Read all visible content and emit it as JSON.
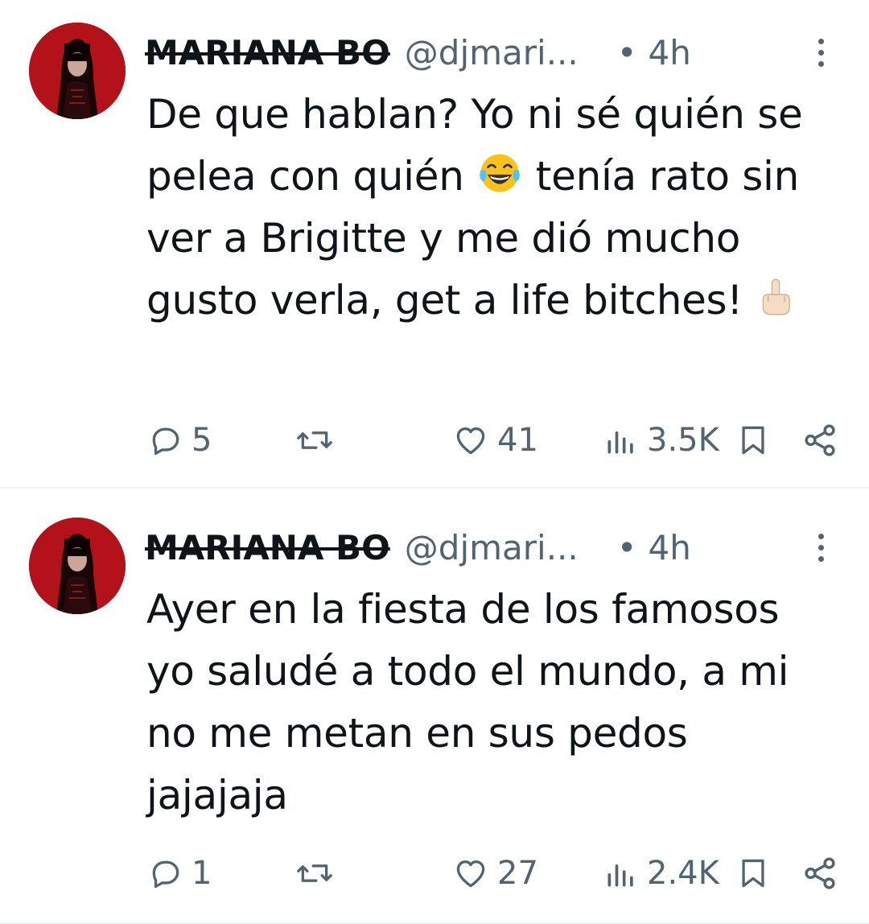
{
  "tweets": [
    {
      "display_name": "MARIANA BO",
      "handle": "@djmari...",
      "dot": "•",
      "time": "4h",
      "text_parts": [
        "De que hablan? Yo ni sé quién se pelea con quién ",
        " tenía rato sin ver a Brigitte y me dió mucho gusto verla, get a life bitches! "
      ],
      "emojis": [
        "face-with-tears-of-joy",
        "middle-finger"
      ],
      "replies": "5",
      "reposts": "",
      "likes": "41",
      "views": "3.5K"
    },
    {
      "display_name": "MARIANA BO",
      "handle": "@djmari...",
      "dot": "•",
      "time": "4h",
      "text": "Ayer en la fiesta de los famosos yo saludé a todo el mundo, a mi no me metan en sus pedos jajajaja",
      "replies": "1",
      "reposts": "",
      "likes": "27",
      "views": "2.4K"
    }
  ],
  "icons": {
    "reply": "reply-icon",
    "repost": "repost-icon",
    "like": "heart-icon",
    "views": "views-icon",
    "bookmark": "bookmark-icon",
    "share": "share-icon",
    "more": "more-icon"
  },
  "colors": {
    "text": "#0f1419",
    "secondary": "#536471",
    "divider": "#eff3f4",
    "avatar_bg": "#b3121a"
  }
}
